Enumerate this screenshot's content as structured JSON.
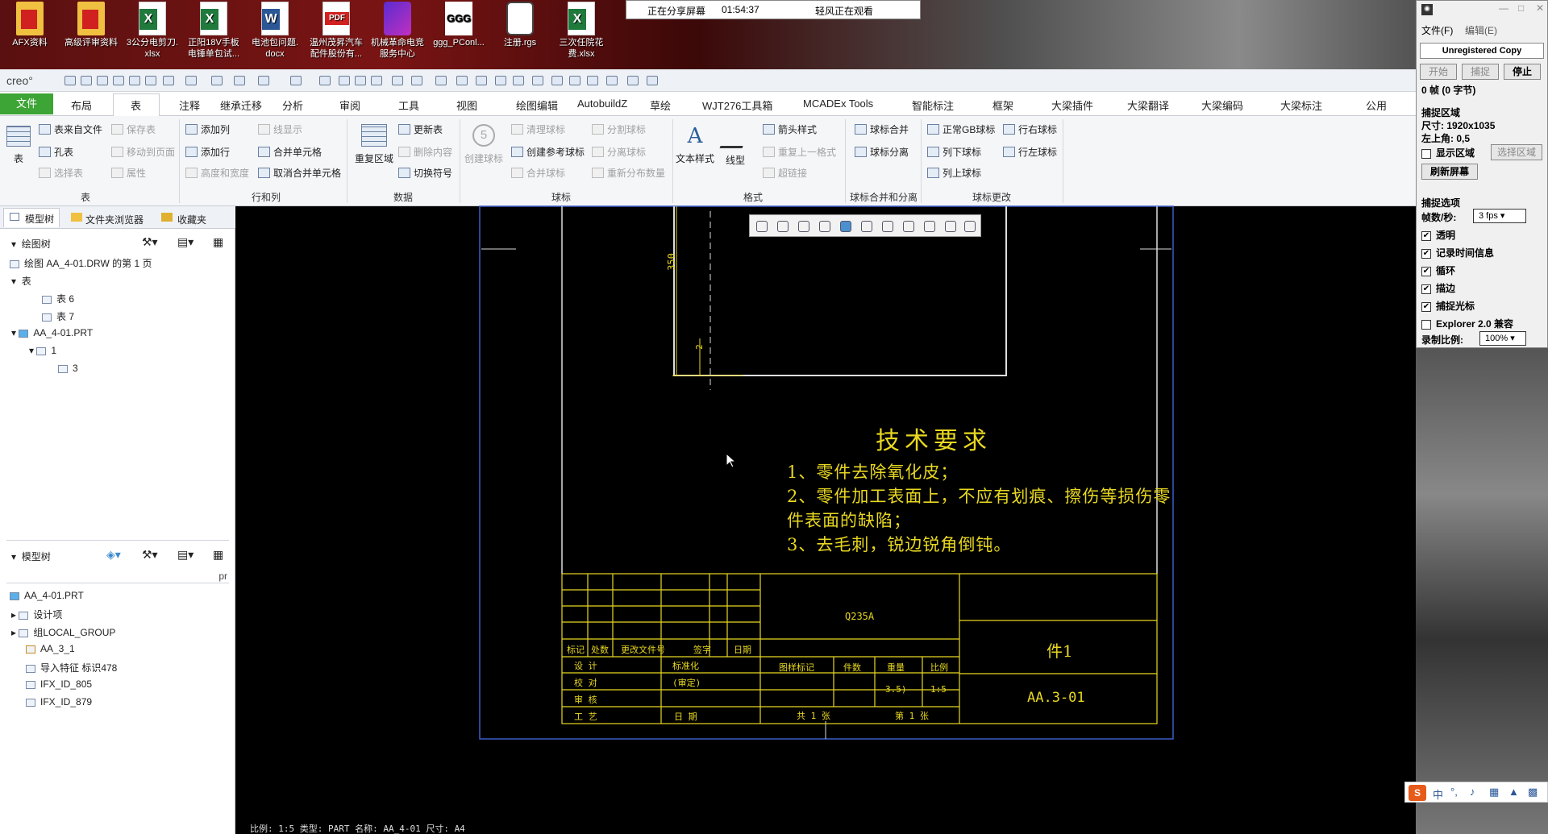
{
  "desktop": {
    "icons": [
      {
        "l1": "AFX资料",
        "l2": "",
        "kind": "folder"
      },
      {
        "l1": "高级评审资料",
        "l2": "",
        "kind": "folder"
      },
      {
        "l1": "3公分电剪刀.",
        "l2": "xlsx",
        "kind": "xls"
      },
      {
        "l1": "正阳18V手板",
        "l2": "电锤单包试...",
        "kind": "xls"
      },
      {
        "l1": "电池包问题.",
        "l2": "docx",
        "kind": "doc"
      },
      {
        "l1": "温州茂昇汽车",
        "l2": "配件股份有...",
        "kind": "pdf"
      },
      {
        "l1": "机械革命电竞",
        "l2": "服务中心",
        "kind": "app"
      },
      {
        "l1": "ggg_PConl...",
        "l2": "",
        "kind": "ggg"
      },
      {
        "l1": "注册.rgs",
        "l2": "",
        "kind": "reg"
      },
      {
        "l1": "三次任院花",
        "l2": "费.xlsx",
        "kind": "xls"
      }
    ],
    "ggg_glyph": "GGG",
    "pdf_glyph": "PDF"
  },
  "share": {
    "status": "正在分享屏幕",
    "time": "01:54:37",
    "watcher": "轻风正在观看"
  },
  "app": {
    "logo": "creo°"
  },
  "tabs": [
    "文件",
    "布局",
    "表",
    "注释",
    "继承迁移",
    "分析",
    "审阅",
    "工具",
    "视图",
    "绘图编辑",
    "AutobuildZ",
    "草绘",
    "WJT276工具箱",
    "MCADEx Tools",
    "智能标注",
    "框架",
    "大梁插件",
    "大梁翻译",
    "大梁编码",
    "大梁标注",
    "公用"
  ],
  "ribbon": {
    "table_big": "表",
    "table_col1": [
      "表来自文件",
      "孔表",
      "选择表"
    ],
    "table_col2": [
      "保存表",
      "移动到页面",
      "属性"
    ],
    "g_table": "表",
    "rowcol_col1": [
      "添加列",
      "添加行",
      "高度和宽度"
    ],
    "rowcol_col2": [
      "线显示",
      "合并单元格",
      "取消合并单元格"
    ],
    "g_rowcol": "行和列",
    "data_big": "重复区域",
    "data_col": [
      "更新表",
      "删除内容",
      "切换符号"
    ],
    "g_data": "数据",
    "balloon_big": "创建球标",
    "balloon_col1": [
      "清理球标",
      "创建参考球标",
      "合并球标"
    ],
    "balloon_col2": [
      "分割球标",
      "分离球标",
      "重新分布数量"
    ],
    "g_balloon": "球标",
    "fmt_big1": "文本样式",
    "fmt_big2": "线型",
    "fmt_col": [
      "箭头样式",
      "重复上一格式",
      "超链接"
    ],
    "g_fmt": "格式",
    "merge_col": [
      "球标合并",
      "球标分离"
    ],
    "g_merge": "球标合并和分离",
    "chg_col1": [
      "正常GB球标",
      "列下球标",
      "列上球标"
    ],
    "chg_col2": [
      "行右球标",
      "行左球标"
    ],
    "g_chg": "球标更改"
  },
  "leftpane": {
    "tabs": [
      "模型树",
      "文件夹浏览器",
      "收藏夹"
    ],
    "draw_tree_title": "绘图树",
    "draw_tree": [
      "绘图 AA_4-01.DRW 的第 1 页",
      "表",
      "表 6",
      "表 7",
      "AA_4-01.PRT",
      "1",
      "3"
    ],
    "model_tree_title": "模型树",
    "pr_label": "pr",
    "model_tree": [
      "AA_4-01.PRT",
      "设计项",
      "组LOCAL_GROUP",
      "AA_3_1",
      "导入特征 标识478",
      "IFX_ID_805",
      "IFX_ID_879"
    ]
  },
  "drawing": {
    "dim_350": "350",
    "dim_2": "2",
    "tech_title": "技术要求",
    "tech_lines": [
      "1、零件去除氧化皮；",
      "2、零件加工表面上，不应有划痕、擦伤等损伤零",
      "件表面的缺陷；",
      "3、去毛刺，锐边锐角倒钝。"
    ],
    "material": "Q235A",
    "part_name": "件1",
    "drawing_no": "AA.3-01",
    "tb_header": [
      "标记",
      "处数",
      "更改文件号",
      "签字",
      "日期"
    ],
    "tb_rows": [
      "设 计",
      "校 对",
      "审 核",
      "工 艺"
    ],
    "tb_std": "标准化",
    "tb_review": "(审定)",
    "tb_date": "日 期",
    "tb_cols": [
      "图样标记",
      "件数",
      "重量",
      "比例"
    ],
    "weight": "3.5)",
    "scale": "1:5",
    "sheets_total": "共 1 张",
    "sheet_no": "第 1 张"
  },
  "status": "比例: 1:5      类型: PART   名称: AA_4-01   尺寸: A4",
  "capture": {
    "menu_file": "文件(F)",
    "menu_edit": "编辑(E)",
    "unreg": "Unregistered Copy",
    "btn_start": "开始",
    "btn_capture": "捕捉",
    "btn_stop": "停止",
    "frames": "0 帧 (0 字节)",
    "region_title": "捕捉区域",
    "size": "尺寸: 1920x1035",
    "topleft": "左上角: 0,5",
    "show_region": "显示区域",
    "select_region": "选择区域",
    "refresh": "刷新屏幕",
    "options_title": "捕捉选项",
    "fps_label": "帧数/秒:",
    "fps_value": "3 fps",
    "opts": [
      "透明",
      "记录时间信息",
      "循环",
      "描边",
      "捕捉光标",
      "Explorer 2.0 兼容"
    ],
    "opts_checked": [
      true,
      true,
      true,
      true,
      true,
      false
    ],
    "ratio_label": "录制比例:",
    "ratio_value": "100%"
  },
  "ime": {
    "logo": "S",
    "mode": "中"
  },
  "colors": {
    "accent_green": "#3da535",
    "drawing_yellow": "#e8d820",
    "drawing_blue": "#3a5cc8"
  }
}
